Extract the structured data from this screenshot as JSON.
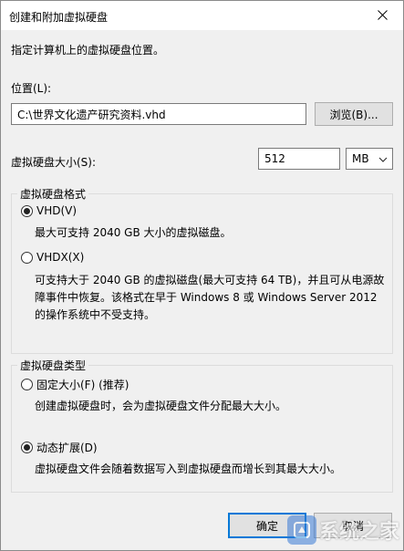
{
  "window": {
    "title": "创建和附加虚拟硬盘"
  },
  "instruction": "指定计算机上的虚拟硬盘位置。",
  "location": {
    "label": "位置(L):",
    "value": "C:\\世界文化遗产研究资料.vhd",
    "browse_label": "浏览(B)..."
  },
  "size": {
    "label": "虚拟硬盘大小(S):",
    "value": "512",
    "unit": "MB"
  },
  "format_group": {
    "title": "虚拟硬盘格式",
    "vhd_label": "VHD(V)",
    "vhd_selected": true,
    "vhd_desc": "最大可支持 2040 GB 大小的虚拟磁盘。",
    "vhdx_label": "VHDX(X)",
    "vhdx_selected": false,
    "vhdx_desc_1": "可支持大于 2040 GB 的虚拟磁盘(最大可支持 64 TB)，并且可从电源故",
    "vhdx_desc_2": "障事件中恢复。该格式在早于 Windows 8 或 Windows Server 2012",
    "vhdx_desc_3": "的操作系统中不受支持。"
  },
  "type_group": {
    "title": "虚拟硬盘类型",
    "fixed_label": "固定大小(F) (推荐)",
    "fixed_selected": false,
    "fixed_desc": "创建虚拟硬盘时，会为虚拟硬盘文件分配最大大小。",
    "dynamic_label": "动态扩展(D)",
    "dynamic_selected": true,
    "dynamic_desc": "虚拟硬盘文件会随着数据写入到虚拟硬盘而增长到其最大大小。"
  },
  "buttons": {
    "ok_label": "确定",
    "cancel_label": "取消"
  },
  "watermark": {
    "text": "系统之家"
  },
  "colors": {
    "dialog_bg": "#f0f0f0",
    "accent": "#0078d7"
  }
}
